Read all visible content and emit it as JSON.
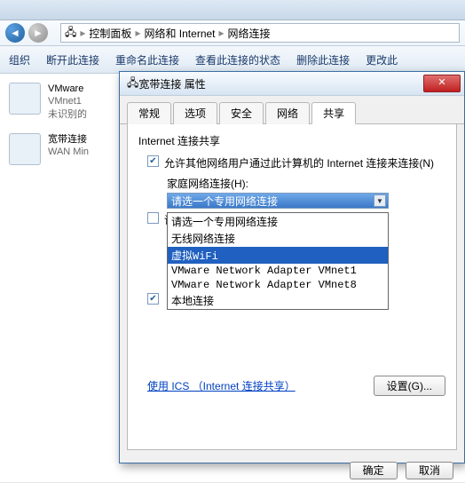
{
  "addressbar": {
    "crumbs": [
      "控制面板",
      "网络和 Internet",
      "网络连接"
    ]
  },
  "toolbar": {
    "organize": "组织",
    "disconnect": "断开此连接",
    "rename": "重命名此连接",
    "status": "查看此连接的状态",
    "delete": "删除此连接",
    "change": "更改此"
  },
  "adapters": [
    {
      "title": "VMware",
      "line2": "VMnet1",
      "line3": "未识别的"
    },
    {
      "title": "宽带连接",
      "line2": "",
      "line3": "WAN Min"
    }
  ],
  "dialog": {
    "title": "宽带连接 属性",
    "tabs": [
      "常规",
      "选项",
      "安全",
      "网络",
      "共享"
    ],
    "active_tab": "共享",
    "group": "Internet 连接共享",
    "opt1": "允许其他网络用户通过此计算机的 Internet 连接来连接(N)",
    "combo_label": "家庭网络连接(H):",
    "combo_value": "请选一个专用网络连接",
    "dropdown": [
      "请选一个专用网络连接",
      "无线网络连接",
      "虚拟WiFi",
      "VMware Network Adapter VMnet1",
      "VMware Network Adapter VMnet8",
      "本地连接"
    ],
    "opt2_a": "请选一个专用网络连接",
    "opt3": "",
    "link": "使用 ICS （Internet 连接共享）",
    "settings_btn": "设置(G)...",
    "ok": "确定",
    "cancel": "取消"
  }
}
